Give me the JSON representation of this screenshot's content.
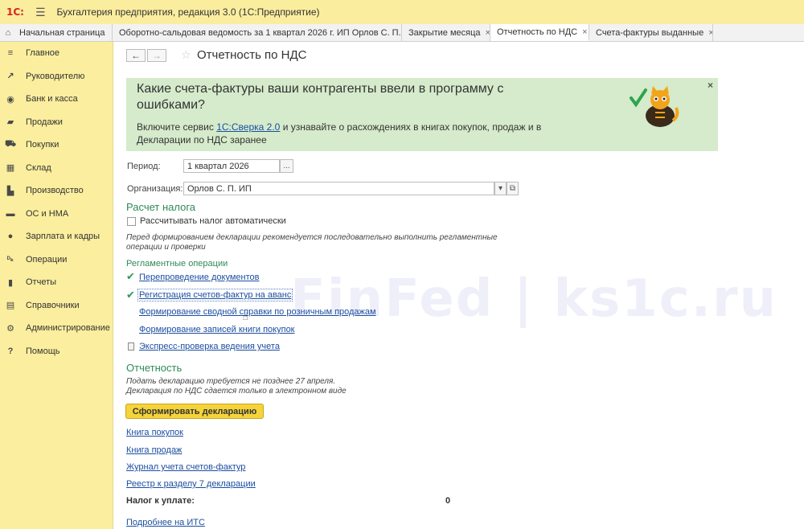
{
  "app": {
    "logo": "1С:",
    "title": "Бухгалтерия предприятия, редакция 3.0  (1С:Предприятие)"
  },
  "tabs": {
    "home": "Начальная страница",
    "items": [
      {
        "label": "Оборотно-сальдовая ведомость за 1 квартал 2026 г. ИП Орлов С. П."
      },
      {
        "label": "Закрытие месяца"
      },
      {
        "label": "Отчетность по НДС"
      },
      {
        "label": "Счета-фактуры выданные"
      }
    ],
    "active": "Отчетность по НДС"
  },
  "sidebar": {
    "items": [
      {
        "label": "Главное",
        "icon": "menu-icon"
      },
      {
        "label": "Руководителю",
        "icon": "trend-icon"
      },
      {
        "label": "Банк и касса",
        "icon": "bank-icon"
      },
      {
        "label": "Продажи",
        "icon": "bag-icon"
      },
      {
        "label": "Покупки",
        "icon": "cart-icon"
      },
      {
        "label": "Склад",
        "icon": "grid-icon"
      },
      {
        "label": "Производство",
        "icon": "factory-icon"
      },
      {
        "label": "ОС и НМА",
        "icon": "truck-icon"
      },
      {
        "label": "Зарплата и кадры",
        "icon": "person-icon"
      },
      {
        "label": "Операции",
        "icon": "operations-icon"
      },
      {
        "label": "Отчеты",
        "icon": "bar-chart-icon"
      },
      {
        "label": "Справочники",
        "icon": "book-icon"
      },
      {
        "label": "Администрирование",
        "icon": "gear-icon"
      },
      {
        "label": "Помощь",
        "icon": "help-icon"
      }
    ]
  },
  "page": {
    "title": "Отчетность по НДС",
    "nav_back": "←",
    "nav_forward": "→",
    "star": "☆"
  },
  "banner": {
    "heading": "Какие счета-фактуры ваши контрагенты ввели в программу с ошибками?",
    "text_before": "Включите сервис ",
    "link": "1С:Сверка 2.0",
    "text_after": " и узнавайте о расхождениях в книгах покупок, продаж и в Декларации по НДС заранее",
    "close": "×"
  },
  "form": {
    "period_label": "Период:",
    "period_value": "1 квартал 2026",
    "period_btn": "...",
    "org_label": "Организация:",
    "org_value": "Орлов С. П. ИП",
    "org_dropdown": "▾",
    "org_open": "⧉"
  },
  "tax_calc": {
    "heading": "Расчет налога",
    "auto_checkbox": "Рассчитывать налог автоматически",
    "auto_checked": false,
    "note": "Перед формированием декларации рекомендуется последовательно выполнить регламентные операции и проверки",
    "ops_heading": "Регламентные операции",
    "ops": [
      {
        "label": "Перепроведение документов",
        "done": true
      },
      {
        "label": "Регистрация счетов-фактур на аванс",
        "done": true
      },
      {
        "label": "Формирование сводной справки по розничным продажам",
        "done": false
      },
      {
        "label": "Формирование записей книги покупок",
        "done": false
      }
    ],
    "express_check": "Экспресс-проверка ведения учета"
  },
  "reporting": {
    "heading": "Отчетность",
    "note_line1": "Подать декларацию требуется не позднее 27 апреля.",
    "note_line2": "Декларация по НДС сдается только в электронном виде",
    "generate_button": "Сформировать декларацию",
    "links": [
      {
        "label": "Книга покупок"
      },
      {
        "label": "Книга продаж"
      },
      {
        "label": "Журнал учета счетов-фактур"
      },
      {
        "label": "Реестр к разделу 7 декларации"
      }
    ],
    "tax_due_label": "Налог к уплате:",
    "tax_due_value": "0",
    "more_link": "Подробнее на ИТС"
  },
  "watermark": "FinFed | ks1c.ru",
  "colors": {
    "title_bar": "#fbed9e",
    "sidebar": "#fbee9e",
    "banner": "#d5ebcb",
    "section_green": "#2f8a57",
    "link_blue": "#1c4ea0",
    "button_yellow": "#f5d33a"
  }
}
